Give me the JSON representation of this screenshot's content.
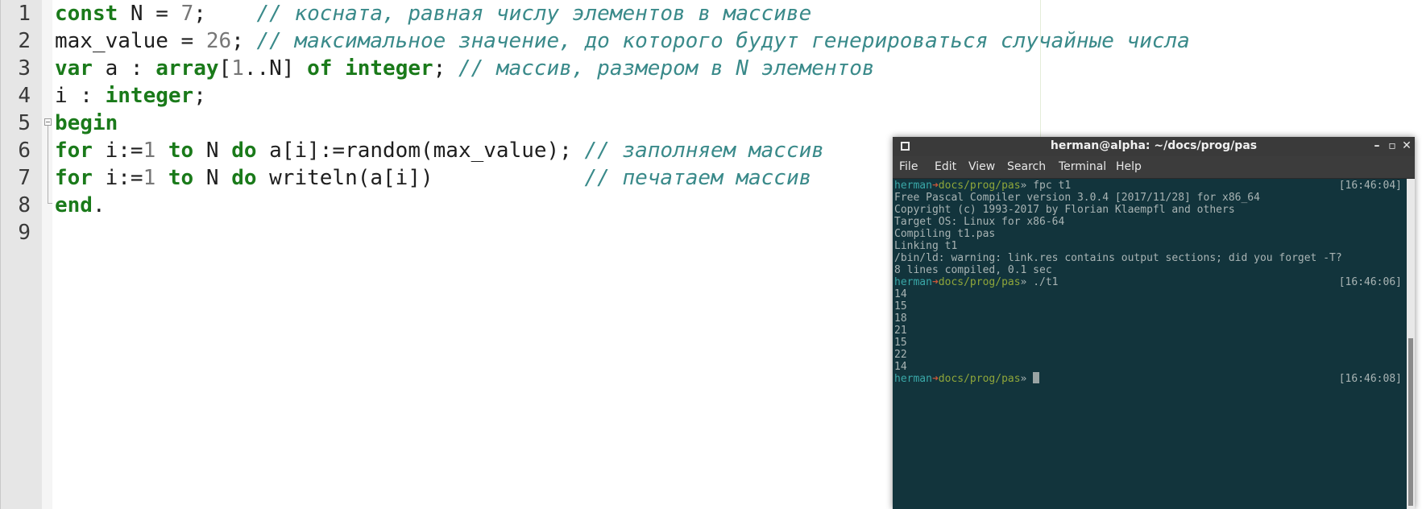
{
  "editor": {
    "line_numbers": [
      "1",
      "2",
      "3",
      "4",
      "5",
      "6",
      "7",
      "8",
      "9"
    ],
    "lines": [
      [
        {
          "t": "const",
          "k": "kw"
        },
        {
          "t": " N = ",
          "k": "tx"
        },
        {
          "t": "7",
          "k": "num"
        },
        {
          "t": ";    ",
          "k": "tx"
        },
        {
          "t": "// косната, равная числу элементов в массиве",
          "k": "cm"
        }
      ],
      [
        {
          "t": "max_value = ",
          "k": "tx"
        },
        {
          "t": "26",
          "k": "num"
        },
        {
          "t": "; ",
          "k": "tx"
        },
        {
          "t": "// максимальное значение, до которого будут генерироваться случайные числа",
          "k": "cm"
        }
      ],
      [
        {
          "t": "var",
          "k": "kw"
        },
        {
          "t": " a : ",
          "k": "tx"
        },
        {
          "t": "array",
          "k": "kw"
        },
        {
          "t": "[",
          "k": "tx"
        },
        {
          "t": "1",
          "k": "num"
        },
        {
          "t": "..N] ",
          "k": "tx"
        },
        {
          "t": "of",
          "k": "kw"
        },
        {
          "t": " ",
          "k": "tx"
        },
        {
          "t": "integer",
          "k": "kw"
        },
        {
          "t": "; ",
          "k": "tx"
        },
        {
          "t": "// массив, размером в N элементов",
          "k": "cm"
        }
      ],
      [
        {
          "t": "i : ",
          "k": "tx"
        },
        {
          "t": "integer",
          "k": "kw"
        },
        {
          "t": ";",
          "k": "tx"
        }
      ],
      [
        {
          "t": "begin",
          "k": "kw"
        }
      ],
      [
        {
          "t": "for",
          "k": "kw"
        },
        {
          "t": " i:=",
          "k": "tx"
        },
        {
          "t": "1",
          "k": "num"
        },
        {
          "t": " ",
          "k": "tx"
        },
        {
          "t": "to",
          "k": "kw"
        },
        {
          "t": " N ",
          "k": "tx"
        },
        {
          "t": "do",
          "k": "kw"
        },
        {
          "t": " a[i]:=random(max_value); ",
          "k": "tx"
        },
        {
          "t": "// заполняем массив",
          "k": "cm"
        }
      ],
      [
        {
          "t": "for",
          "k": "kw"
        },
        {
          "t": " i:=",
          "k": "tx"
        },
        {
          "t": "1",
          "k": "num"
        },
        {
          "t": " ",
          "k": "tx"
        },
        {
          "t": "to",
          "k": "kw"
        },
        {
          "t": " N ",
          "k": "tx"
        },
        {
          "t": "do",
          "k": "kw"
        },
        {
          "t": " writeln(a[i])            ",
          "k": "tx"
        },
        {
          "t": "// печатаем массив",
          "k": "cm"
        }
      ],
      [
        {
          "t": "end",
          "k": "kw"
        },
        {
          "t": ".",
          "k": "tx"
        }
      ],
      []
    ]
  },
  "terminal": {
    "title": "herman@alpha: ~/docs/prog/pas",
    "window_buttons": {
      "minimize": "–",
      "maximize": "▫",
      "close": "✕"
    },
    "menu": [
      "File",
      "Edit",
      "View",
      "Search",
      "Terminal",
      "Help"
    ],
    "prompt": {
      "user": "herman",
      "arrow": "➜",
      "path": "docs/prog/pas",
      "symbol": "»"
    },
    "lines": [
      {
        "type": "prompt",
        "cmd": " fpc t1",
        "time": "[16:46:04]"
      },
      {
        "type": "out",
        "text": "Free Pascal Compiler version 3.0.4 [2017/11/28] for x86_64"
      },
      {
        "type": "out",
        "text": "Copyright (c) 1993-2017 by Florian Klaempfl and others"
      },
      {
        "type": "out",
        "text": "Target OS: Linux for x86-64"
      },
      {
        "type": "out",
        "text": "Compiling t1.pas"
      },
      {
        "type": "out",
        "text": "Linking t1"
      },
      {
        "type": "out",
        "text": "/bin/ld: warning: link.res contains output sections; did you forget -T?"
      },
      {
        "type": "out",
        "text": "8 lines compiled, 0.1 sec"
      },
      {
        "type": "prompt",
        "cmd": " ./t1",
        "time": "[16:46:06]"
      },
      {
        "type": "out",
        "text": "14"
      },
      {
        "type": "out",
        "text": "15"
      },
      {
        "type": "out",
        "text": "18"
      },
      {
        "type": "out",
        "text": "21"
      },
      {
        "type": "out",
        "text": "15"
      },
      {
        "type": "out",
        "text": "22"
      },
      {
        "type": "out",
        "text": "14"
      },
      {
        "type": "prompt",
        "cmd": " ",
        "time": "[16:46:08]",
        "cursor": true
      }
    ]
  }
}
